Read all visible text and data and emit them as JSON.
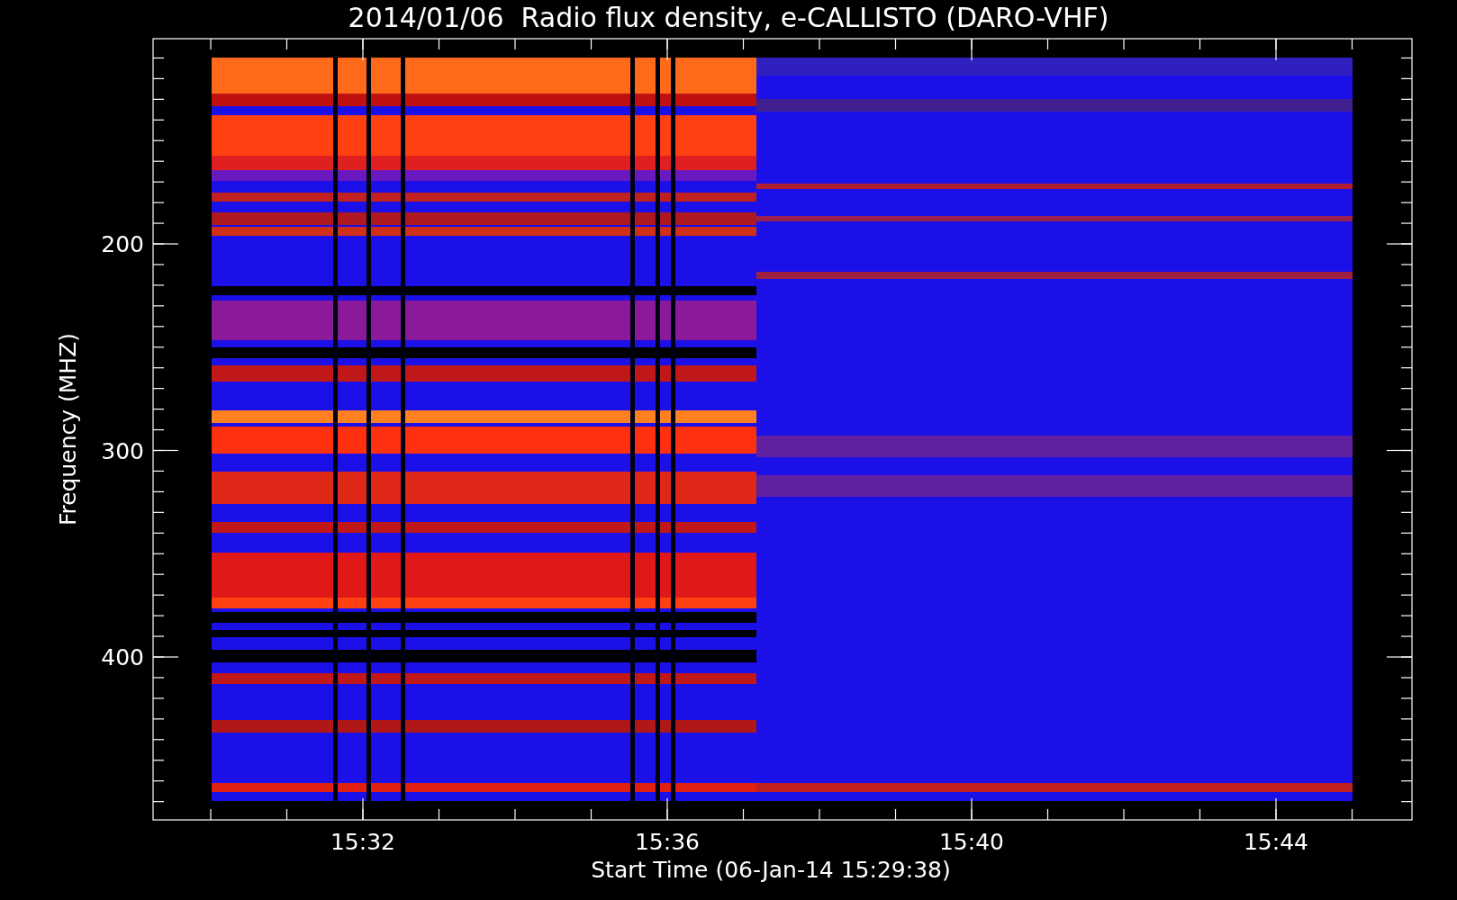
{
  "title": "2014/01/06  Radio flux density, e-CALLISTO (DARO-VHF)",
  "y_axis": {
    "label": "Frequency (MHZ)",
    "ticks": [
      "200",
      "300",
      "400"
    ]
  },
  "x_axis": {
    "label": "Start Time (06-Jan-14 15:29:38)",
    "ticks": [
      "15:32",
      "15:36",
      "15:40",
      "15:44"
    ]
  }
}
